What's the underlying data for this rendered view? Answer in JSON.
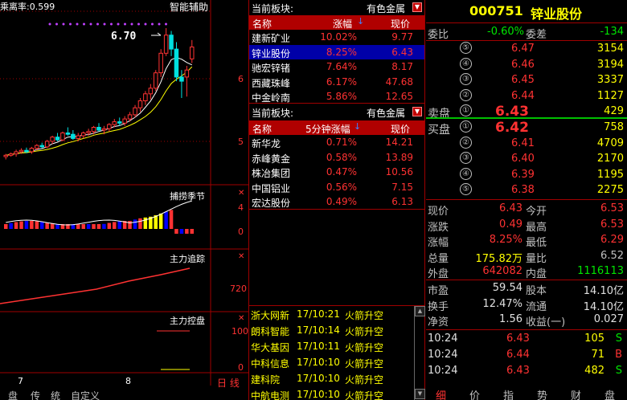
{
  "left_chart": {
    "indicator_label": "乘离率:0.599",
    "assist_label": "智能辅助",
    "high_label": "6.70",
    "price_ticks": [
      "6",
      "5"
    ],
    "panel2_title": "捕捞季节",
    "panel2_ticks": [
      "4",
      "0"
    ],
    "panel3_title": "主力追踪",
    "panel3_ticks": [
      "720"
    ],
    "panel4_title": "主力控盘",
    "panel4_ticks": [
      "100",
      "0"
    ],
    "x_ticks": [
      "7",
      "8"
    ],
    "period_label": "日 线"
  },
  "left_tabs": [
    "盘",
    "传",
    "统",
    "自定义"
  ],
  "sector1": {
    "title": "当前板块:",
    "select": "有色金属",
    "col_name": "名称",
    "col_chg": "涨幅",
    "col_price": "现价",
    "rows": [
      {
        "name": "建新矿业",
        "chg": "10.02%",
        "price": "9.77"
      },
      {
        "name": "锌业股份",
        "chg": "8.25%",
        "price": "6.43"
      },
      {
        "name": "驰宏锌锗",
        "chg": "7.64%",
        "price": "8.17"
      },
      {
        "name": "西藏珠峰",
        "chg": "6.17%",
        "price": "47.68"
      },
      {
        "name": "中金岭南",
        "chg": "5.86%",
        "price": "12.65"
      }
    ]
  },
  "sector2": {
    "title": "当前板块:",
    "select": "有色金属",
    "col_name": "名称",
    "col_chg": "5分钟涨幅",
    "col_price": "现价",
    "rows": [
      {
        "name": "新华龙",
        "chg": "0.71%",
        "price": "14.21"
      },
      {
        "name": "赤峰黄金",
        "chg": "0.58%",
        "price": "13.89"
      },
      {
        "name": "株冶集团",
        "chg": "0.47%",
        "price": "10.56"
      },
      {
        "name": "中国铝业",
        "chg": "0.56%",
        "price": "7.15"
      },
      {
        "name": "宏达股份",
        "chg": "0.49%",
        "price": "6.13"
      }
    ]
  },
  "news": [
    {
      "name": "浙大网新",
      "time": "17/10:21",
      "tag": "火箭升空"
    },
    {
      "name": "朗科智能",
      "time": "17/10:14",
      "tag": "火箭升空"
    },
    {
      "name": "华大基因",
      "time": "17/10:11",
      "tag": "火箭升空"
    },
    {
      "name": "中科信息",
      "time": "17/10:10",
      "tag": "火箭升空"
    },
    {
      "name": "建科院",
      "time": "17/10:10",
      "tag": "火箭升空"
    },
    {
      "name": "中航电测",
      "time": "17/10:10",
      "tag": "火箭升空"
    }
  ],
  "stock": {
    "code": "000751",
    "name": "锌业股份",
    "weibi_label": "委比",
    "weibi": "-0.60%",
    "weicha_label": "委差",
    "weicha": "-134",
    "sell_label": "卖盘",
    "buy_label": "买盘",
    "asks": [
      {
        "lvl": "⑤",
        "price": "6.47",
        "vol": "3154"
      },
      {
        "lvl": "④",
        "price": "6.46",
        "vol": "3194"
      },
      {
        "lvl": "③",
        "price": "6.45",
        "vol": "3337"
      },
      {
        "lvl": "②",
        "price": "6.44",
        "vol": "1127"
      },
      {
        "lvl": "①",
        "price": "6.43",
        "vol": "429"
      }
    ],
    "bids": [
      {
        "lvl": "①",
        "price": "6.42",
        "vol": "758"
      },
      {
        "lvl": "②",
        "price": "6.41",
        "vol": "4709"
      },
      {
        "lvl": "③",
        "price": "6.40",
        "vol": "2170"
      },
      {
        "lvl": "④",
        "price": "6.39",
        "vol": "1195"
      },
      {
        "lvl": "⑤",
        "price": "6.38",
        "vol": "2275"
      }
    ],
    "stats": [
      {
        "l1": "现价",
        "v1": "6.43",
        "c1": "red",
        "l2": "今开",
        "v2": "6.53",
        "c2": "red"
      },
      {
        "l1": "涨跌",
        "v1": "0.49",
        "c1": "red",
        "l2": "最高",
        "v2": "6.53",
        "c2": "red"
      },
      {
        "l1": "涨幅",
        "v1": "8.25%",
        "c1": "red",
        "l2": "最低",
        "v2": "6.29",
        "c2": "red"
      },
      {
        "l1": "总量",
        "v1": "175.82万",
        "c1": "yellow",
        "l2": "量比",
        "v2": "6.52",
        "c2": "gray"
      },
      {
        "l1": "外盘",
        "v1": "642082",
        "c1": "red",
        "l2": "内盘",
        "v2": "1116113",
        "c2": "green"
      }
    ],
    "stats2": [
      {
        "l1": "市盈",
        "v1": "59.54",
        "l2": "股本",
        "v2": "14.10亿"
      },
      {
        "l1": "换手",
        "v1": "12.47%",
        "l2": "流通",
        "v2": "14.10亿"
      },
      {
        "l1": "净资",
        "v1": "1.56",
        "l2": "收益(一)",
        "v2": "0.027"
      }
    ],
    "ticks": [
      {
        "time": "10:24",
        "price": "6.43",
        "vol": "105",
        "dir": "S",
        "dcolor": "green"
      },
      {
        "time": "10:24",
        "price": "6.44",
        "vol": "71",
        "dir": "B",
        "dcolor": "red"
      },
      {
        "time": "10:24",
        "price": "6.43",
        "vol": "482",
        "dir": "S",
        "dcolor": "green"
      }
    ]
  },
  "right_tabs": [
    "细",
    "价",
    "指",
    "势",
    "财",
    "盘"
  ],
  "chart_data": {
    "type": "candlestick",
    "candles": [
      {
        "o": 4.86,
        "h": 4.9,
        "l": 4.82,
        "c": 4.88
      },
      {
        "o": 4.88,
        "h": 4.92,
        "l": 4.86,
        "c": 4.9
      },
      {
        "o": 4.9,
        "h": 4.96,
        "l": 4.86,
        "c": 4.93
      },
      {
        "o": 4.93,
        "h": 4.98,
        "l": 4.9,
        "c": 4.95
      },
      {
        "o": 4.95,
        "h": 4.99,
        "l": 4.91,
        "c": 4.93
      },
      {
        "o": 4.93,
        "h": 5.0,
        "l": 4.9,
        "c": 4.98
      },
      {
        "o": 4.98,
        "h": 5.04,
        "l": 4.95,
        "c": 5.02
      },
      {
        "o": 5.02,
        "h": 5.06,
        "l": 4.98,
        "c": 5.0
      },
      {
        "o": 5.0,
        "h": 5.1,
        "l": 4.98,
        "c": 5.08
      },
      {
        "o": 5.08,
        "h": 5.16,
        "l": 5.04,
        "c": 5.14
      },
      {
        "o": 5.14,
        "h": 5.2,
        "l": 5.08,
        "c": 5.1
      },
      {
        "o": 5.1,
        "h": 5.22,
        "l": 5.08,
        "c": 5.2
      },
      {
        "o": 5.2,
        "h": 5.28,
        "l": 5.16,
        "c": 5.18
      },
      {
        "o": 5.18,
        "h": 5.24,
        "l": 5.1,
        "c": 5.12
      },
      {
        "o": 5.12,
        "h": 5.2,
        "l": 5.08,
        "c": 5.16
      },
      {
        "o": 5.16,
        "h": 5.22,
        "l": 5.12,
        "c": 5.2
      },
      {
        "o": 5.2,
        "h": 5.26,
        "l": 5.16,
        "c": 5.22
      },
      {
        "o": 5.22,
        "h": 5.3,
        "l": 5.18,
        "c": 5.28
      },
      {
        "o": 5.28,
        "h": 5.34,
        "l": 5.22,
        "c": 5.24
      },
      {
        "o": 5.24,
        "h": 5.3,
        "l": 5.18,
        "c": 5.26
      },
      {
        "o": 5.26,
        "h": 5.34,
        "l": 5.22,
        "c": 5.32
      },
      {
        "o": 5.32,
        "h": 5.4,
        "l": 5.28,
        "c": 5.36
      },
      {
        "o": 5.36,
        "h": 5.42,
        "l": 5.3,
        "c": 5.34
      },
      {
        "o": 5.34,
        "h": 5.44,
        "l": 5.3,
        "c": 5.4
      },
      {
        "o": 5.4,
        "h": 5.5,
        "l": 5.36,
        "c": 5.46
      },
      {
        "o": 5.46,
        "h": 5.6,
        "l": 5.42,
        "c": 5.56
      },
      {
        "o": 5.56,
        "h": 5.7,
        "l": 5.5,
        "c": 5.66
      },
      {
        "o": 5.66,
        "h": 5.8,
        "l": 5.6,
        "c": 5.76
      },
      {
        "o": 5.76,
        "h": 5.9,
        "l": 5.68,
        "c": 5.84
      },
      {
        "o": 5.84,
        "h": 6.1,
        "l": 5.8,
        "c": 6.06
      },
      {
        "o": 6.06,
        "h": 6.4,
        "l": 6.0,
        "c": 6.34
      },
      {
        "o": 6.34,
        "h": 6.7,
        "l": 6.3,
        "c": 6.6
      },
      {
        "o": 6.6,
        "h": 6.66,
        "l": 6.3,
        "c": 6.4
      },
      {
        "o": 6.4,
        "h": 6.5,
        "l": 5.94,
        "c": 6.0
      },
      {
        "o": 6.0,
        "h": 6.1,
        "l": 5.7,
        "c": 5.94
      },
      {
        "o": 6.0,
        "h": 6.16,
        "l": 5.72,
        "c": 6.1
      },
      {
        "o": 6.26,
        "h": 6.53,
        "l": 6.2,
        "c": 6.43
      }
    ]
  }
}
